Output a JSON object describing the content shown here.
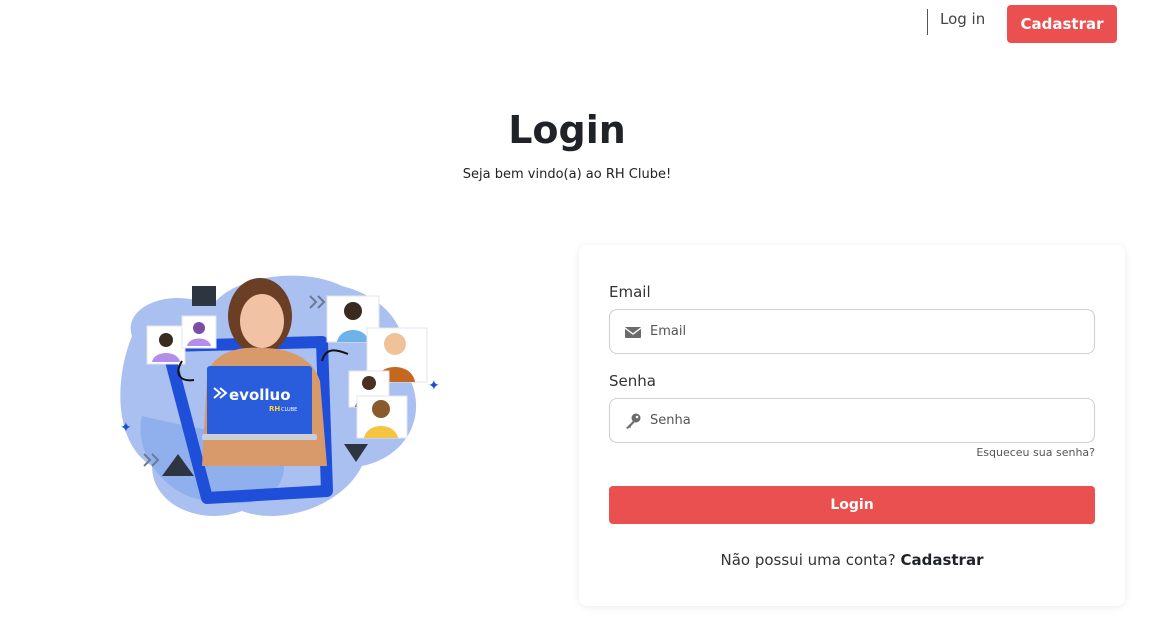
{
  "nav": {
    "login_label": "Log in",
    "register_label": "Cadastrar"
  },
  "header": {
    "title": "Login",
    "subtitle": "Seja bem vindo(a) ao RH Clube!"
  },
  "illustration": {
    "brand_text": "evolluo",
    "brand_sub": "RH",
    "brand_sub2": "CLUBE"
  },
  "form": {
    "email_label": "Email",
    "email_placeholder": "Email",
    "password_label": "Senha",
    "password_placeholder": "Senha",
    "forgot_label": "Esqueceu sua senha?",
    "submit_label": "Login",
    "no_account_text": "Não possui uma conta?",
    "register_link": "Cadastrar"
  },
  "colors": {
    "accent": "#ea5050",
    "illustration_blue": "#1f4fd8",
    "blob_blue": "#a9c0f0"
  },
  "icons": {
    "email": "envelope-icon",
    "password": "key-icon"
  }
}
